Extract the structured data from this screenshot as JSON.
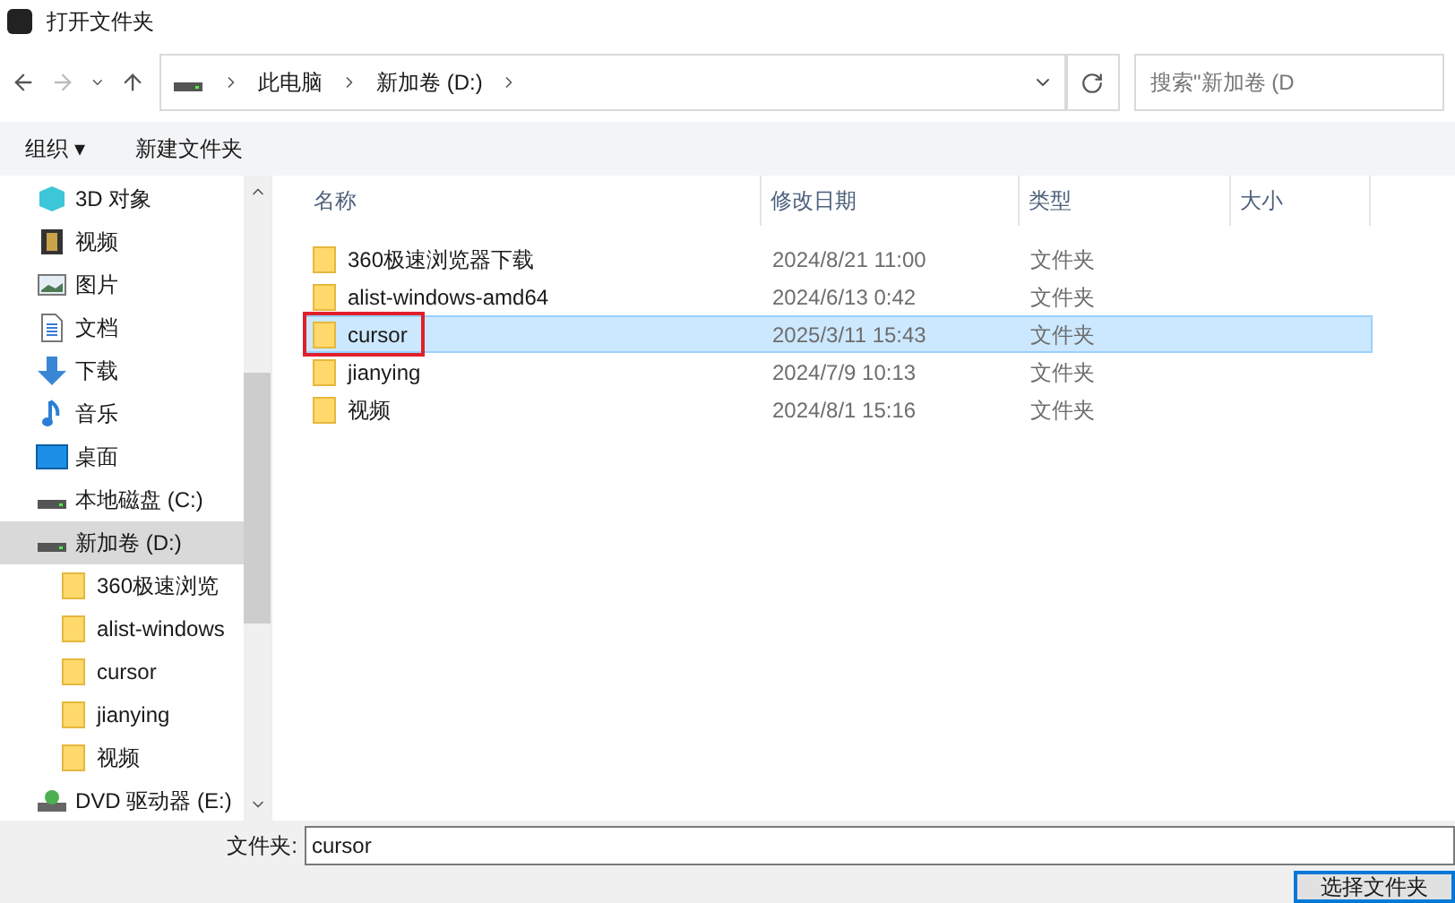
{
  "window": {
    "title": "打开文件夹"
  },
  "address_bar": {
    "crumbs": [
      "此电脑",
      "新加卷 (D:)"
    ],
    "search_placeholder": "搜索\"新加卷 (D"
  },
  "toolbar": {
    "organize": "组织 ▾",
    "new_folder": "新建文件夹"
  },
  "sidebar": {
    "items": [
      {
        "label": "3D 对象",
        "kind": "cube",
        "selected": false
      },
      {
        "label": "视频",
        "kind": "video",
        "selected": false
      },
      {
        "label": "图片",
        "kind": "picture",
        "selected": false
      },
      {
        "label": "文档",
        "kind": "document",
        "selected": false
      },
      {
        "label": "下载",
        "kind": "download",
        "selected": false
      },
      {
        "label": "音乐",
        "kind": "music",
        "selected": false
      },
      {
        "label": "桌面",
        "kind": "desktop",
        "selected": false
      },
      {
        "label": "本地磁盘 (C:)",
        "kind": "drive",
        "selected": false
      },
      {
        "label": "新加卷 (D:)",
        "kind": "drive",
        "selected": true,
        "children": [
          {
            "label": "360极速浏览",
            "kind": "folder",
            "selected": false
          },
          {
            "label": "alist-windows",
            "kind": "folder",
            "selected": false
          },
          {
            "label": "cursor",
            "kind": "folder",
            "selected": false
          },
          {
            "label": "jianying",
            "kind": "folder",
            "selected": false
          },
          {
            "label": "视频",
            "kind": "folder",
            "selected": false
          }
        ]
      },
      {
        "label": "DVD 驱动器 (E:)",
        "kind": "dvd",
        "selected": false
      }
    ]
  },
  "file_list": {
    "columns": [
      "名称",
      "修改日期",
      "类型",
      "大小"
    ],
    "rows": [
      {
        "name": "360极速浏览器下载",
        "modified": "2024/8/21 11:00",
        "type": "文件夹",
        "selected": false
      },
      {
        "name": "alist-windows-amd64",
        "modified": "2024/6/13 0:42",
        "type": "文件夹",
        "selected": false
      },
      {
        "name": "cursor",
        "modified": "2025/3/11 15:43",
        "type": "文件夹",
        "selected": true
      },
      {
        "name": "jianying",
        "modified": "2024/7/9 10:13",
        "type": "文件夹",
        "selected": false
      },
      {
        "name": "视频",
        "modified": "2024/8/1 15:16",
        "type": "文件夹",
        "selected": false
      }
    ]
  },
  "footer": {
    "label": "文件夹:",
    "value": "cursor",
    "button": "选择文件夹"
  }
}
